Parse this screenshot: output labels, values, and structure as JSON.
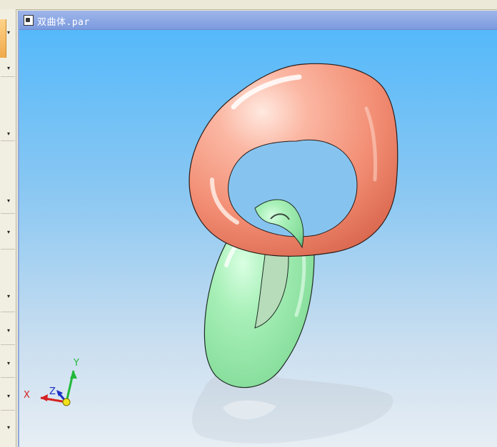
{
  "window": {
    "title": "双曲体.par"
  },
  "left_panel": {
    "chevrons": [
      "▾",
      "▾",
      "▾",
      "▾",
      "▾",
      "▾",
      "▾",
      "▾",
      "▾",
      "▾",
      "▾"
    ]
  },
  "scene": {
    "objects": [
      {
        "name": "orange-ring",
        "color": "#f59b86"
      },
      {
        "name": "green-ring",
        "color": "#93e6a8"
      }
    ],
    "background_top": "#55b9fa",
    "background_bottom": "#e7eef4"
  },
  "triad": {
    "x_label": "X",
    "y_label": "Y",
    "z_label": "Z",
    "x_color": "#d42020",
    "y_color": "#22b83a",
    "z_color": "#1c2fc4"
  }
}
